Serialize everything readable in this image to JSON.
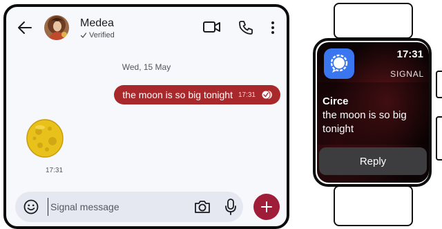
{
  "chat": {
    "contact_name": "Medea",
    "verified_label": "Verified",
    "date_separator": "Wed, 15 May",
    "outgoing_message": {
      "text": "the moon is so big tonight",
      "time": "17:31",
      "status": "read"
    },
    "incoming_sticker": {
      "description_icon": "moon-sticker",
      "time": "17:31"
    },
    "composer": {
      "placeholder": "Signal message"
    }
  },
  "watch": {
    "time": "17:31",
    "app_label": "SIGNAL",
    "notification": {
      "sender": "Circe",
      "message": "the moon is so big tonight"
    },
    "reply_label": "Reply"
  },
  "icons": [
    "back-arrow-icon",
    "video-call-icon",
    "phone-icon",
    "more-vertical-icon",
    "check-icon",
    "read-receipt-icon",
    "emoji-icon",
    "camera-icon",
    "mic-icon",
    "plus-icon",
    "signal-logo-icon"
  ],
  "colors": {
    "outgoing_bubble": "#a8282c",
    "add_button": "#a01d3a",
    "signal_blue": "#3a76f0",
    "composer_bg": "#e5e8f1",
    "watch_reply_bg": "#3d3d40"
  }
}
